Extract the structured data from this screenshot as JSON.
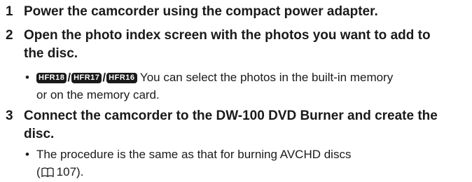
{
  "steps": [
    {
      "number": "1",
      "lines": [
        "Power the camcorder using the compact power adapter."
      ]
    },
    {
      "number": "2",
      "lines": [
        "Open the photo index screen with the photos you want to add to",
        "the disc."
      ],
      "bullet": {
        "badges": [
          "HFR18",
          "HFR17",
          "HFR16"
        ],
        "lines": [
          "You can select the photos in the built-in memory",
          "or on the memory card."
        ]
      }
    },
    {
      "number": "3",
      "lines": [
        "Connect the camcorder to the DW-100 DVD Burner and create the",
        "disc."
      ],
      "bullet": {
        "lines": [
          "The procedure is the same as that for burning AVCHD discs",
          "107)."
        ],
        "open_paren": "("
      }
    }
  ],
  "bullet_symbol": "•",
  "icons": {
    "reference": "book-reference-icon"
  }
}
